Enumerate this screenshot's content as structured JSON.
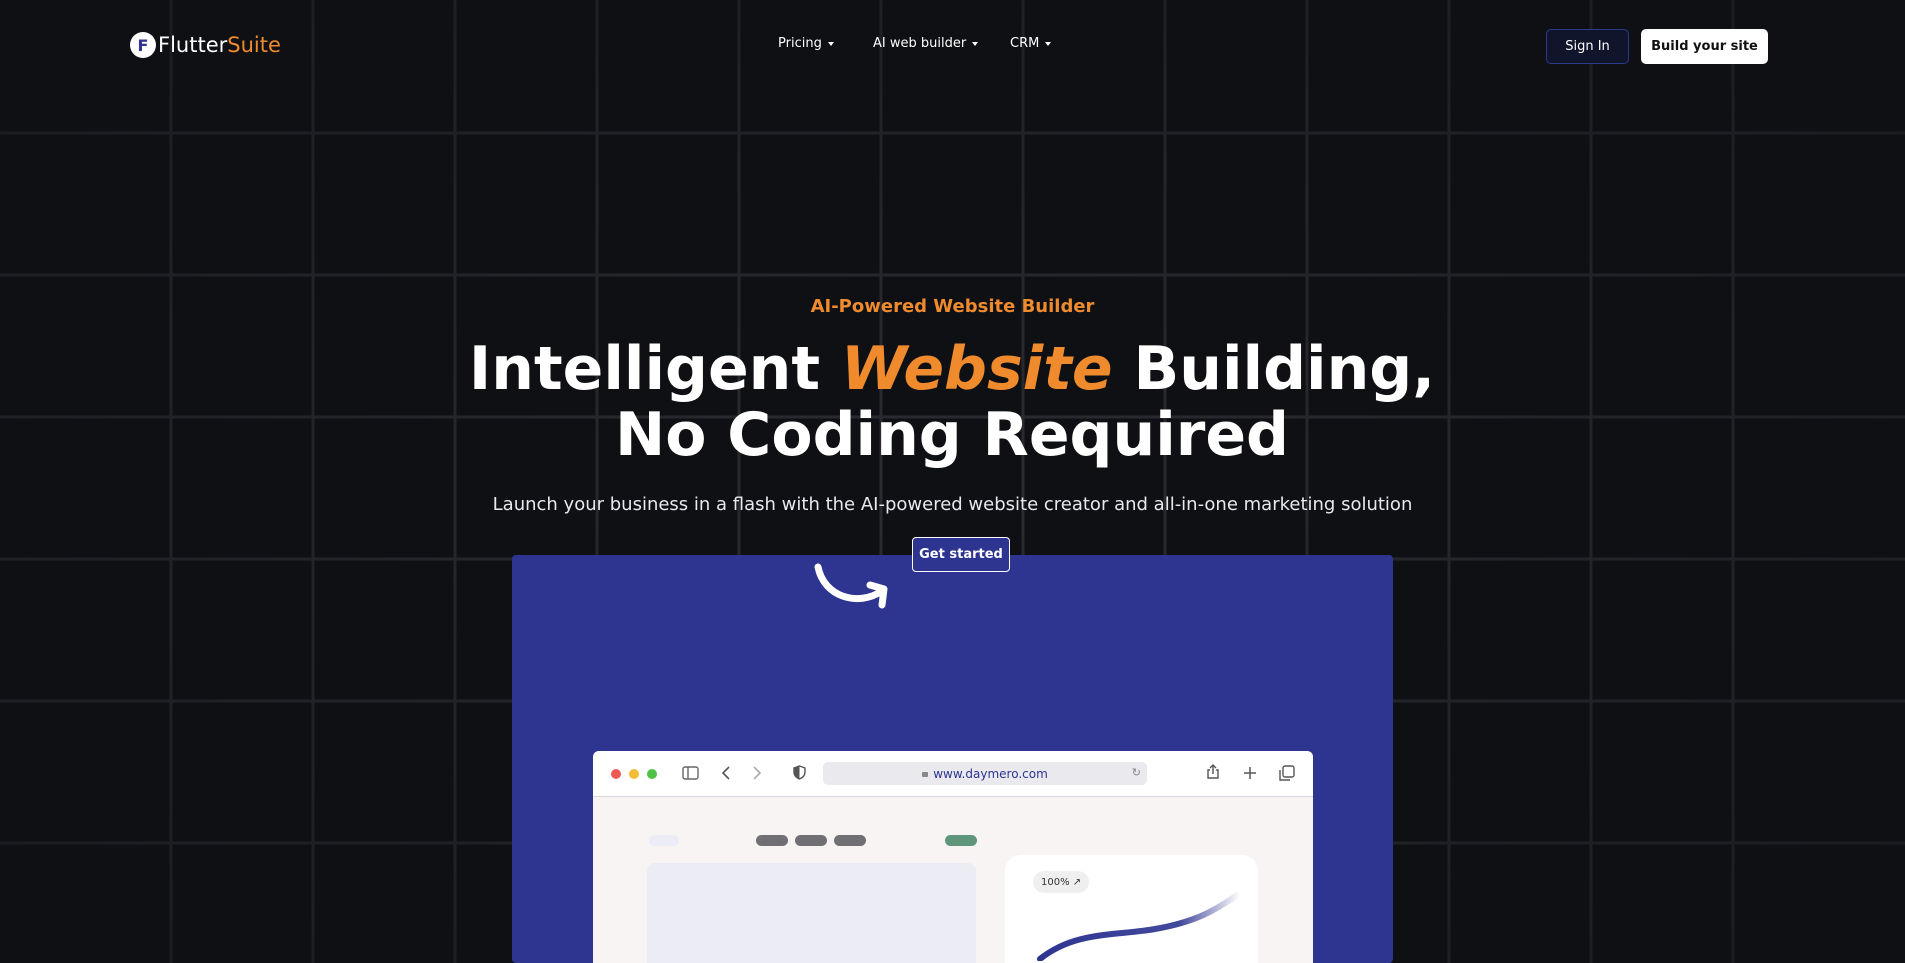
{
  "brand": {
    "logo_letter": "F",
    "name_part1": "Flutter",
    "name_part2": "Suite",
    "accent_color": "#ef8a2d",
    "primary_color": "#2e3591"
  },
  "nav": {
    "items": [
      {
        "label": "Pricing"
      },
      {
        "label": "AI web builder"
      },
      {
        "label": "CRM"
      }
    ]
  },
  "header_actions": {
    "sign_in": "Sign In",
    "build": "Build your site"
  },
  "hero": {
    "eyebrow": "AI-Powered Website Builder",
    "headline_part1": "Intelligent ",
    "headline_accent": "Website",
    "headline_part2": " Building, No Coding Required",
    "subtitle": "Launch your business in a flash with the AI-powered website creator and all-in-one marketing solution",
    "cta": "Get started"
  },
  "browser_mock": {
    "url": "www.daymero.com",
    "badge": "100% ↗"
  },
  "icons": [
    "curved-arrow-icon",
    "sidebar-icon",
    "back-icon",
    "forward-icon",
    "shield-icon",
    "lock-icon",
    "reload-icon",
    "share-icon",
    "new-tab-icon",
    "tabs-icon",
    "caret-down-icon"
  ]
}
